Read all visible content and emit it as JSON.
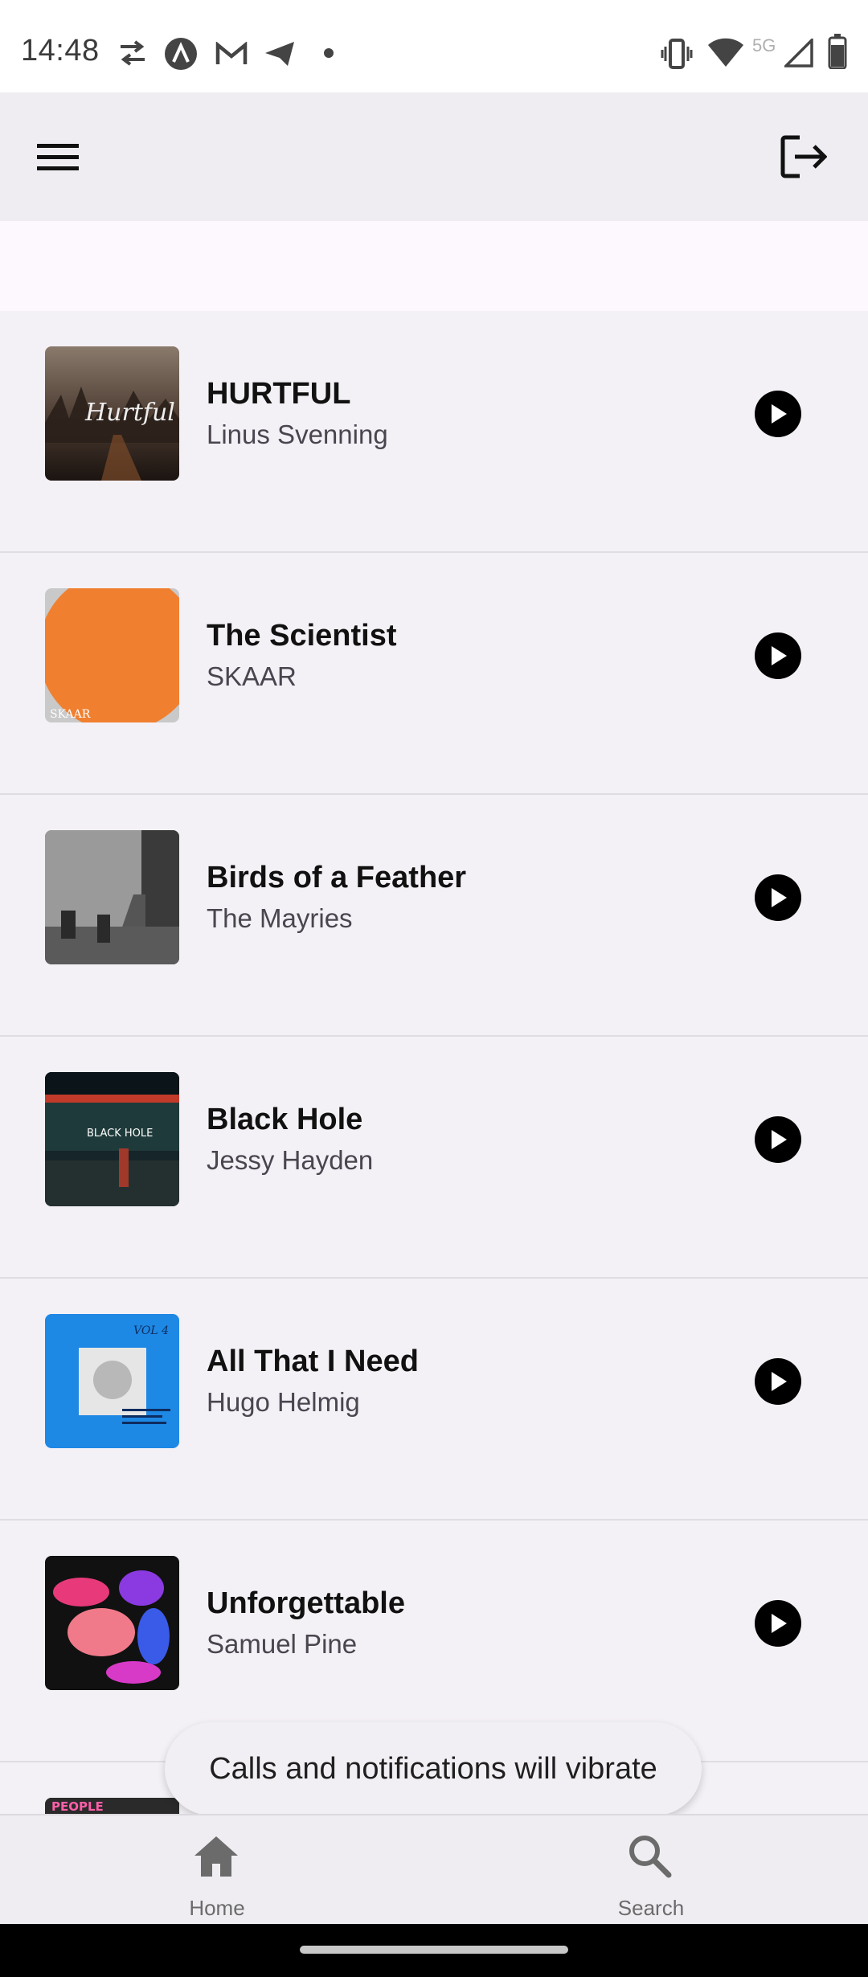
{
  "status_bar": {
    "time": "14:48",
    "network_label": "5G",
    "icons": [
      "sync-icon",
      "app-a-icon",
      "gmail-icon",
      "telegram-icon",
      "dot-icon",
      "vibrate-icon",
      "wifi-icon",
      "signal-icon",
      "battery-icon"
    ]
  },
  "app_bar": {
    "menu_icon": "menu-icon",
    "logout_icon": "logout-icon"
  },
  "songs": [
    {
      "title": "HURTFUL",
      "artist": "Linus Svenning",
      "cover_text": "Hurtful"
    },
    {
      "title": "The Scientist",
      "artist": "SKAAR",
      "cover_text": "SKAAR"
    },
    {
      "title": "Birds of a Feather",
      "artist": "The Mayries",
      "cover_text": ""
    },
    {
      "title": "Black Hole",
      "artist": "Jessy Hayden",
      "cover_text": "BLACK HOLE"
    },
    {
      "title": "All That I Need",
      "artist": "Hugo Helmig",
      "cover_text": "VOL 4"
    },
    {
      "title": "Unforgettable",
      "artist": "Samuel Pine",
      "cover_text": ""
    },
    {
      "title": "",
      "artist": "",
      "cover_text": "PEOPLE"
    }
  ],
  "toast": {
    "message": "Calls and notifications will vibrate"
  },
  "bottom_nav": {
    "items": [
      {
        "label": "Home",
        "icon": "home-icon"
      },
      {
        "label": "Search",
        "icon": "search-icon"
      }
    ]
  },
  "colors": {
    "background": "#f4f1f6",
    "app_bar": "#f0edf2",
    "play_button": "#000000",
    "nav_label": "#6b6b6b"
  }
}
